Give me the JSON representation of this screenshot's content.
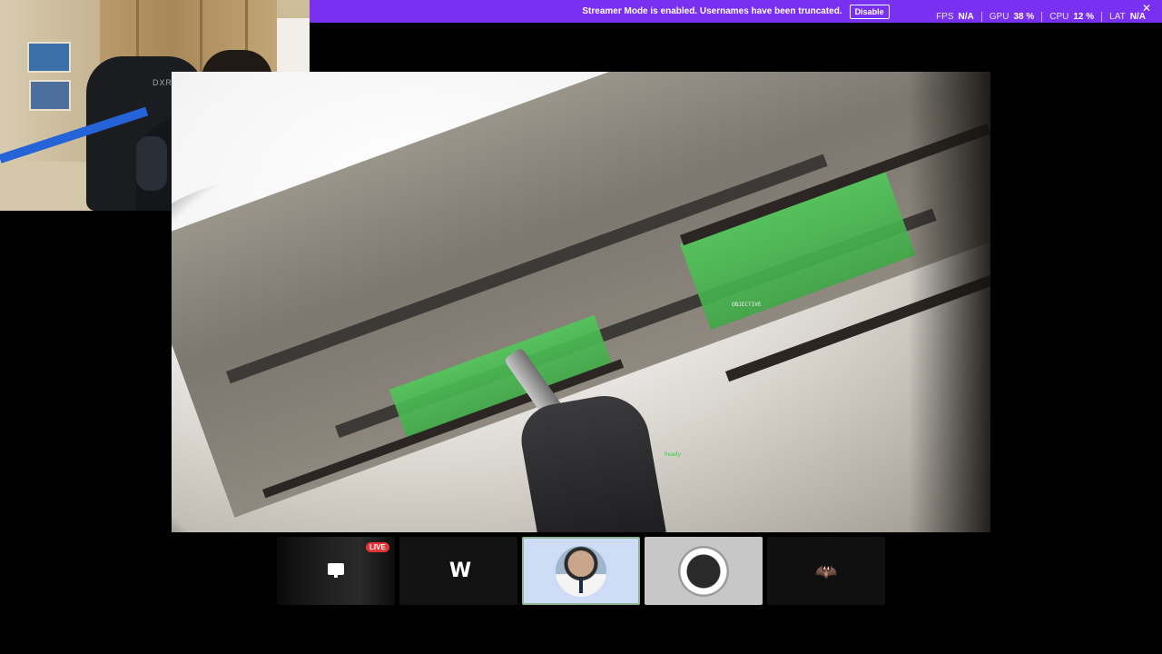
{
  "banner": {
    "message": "Streamer Mode is enabled. Usernames have been truncated.",
    "disable_label": "Disable",
    "close_glyph": "✕",
    "color": "#7a30f0"
  },
  "stats": [
    {
      "label": "FPS",
      "value": "N/A"
    },
    {
      "label": "GPU",
      "value": "38 %"
    },
    {
      "label": "CPU",
      "value": "12 %"
    },
    {
      "label": "LAT",
      "value": "N/A"
    }
  ],
  "webcam": {
    "chair_brand": "DXRACER"
  },
  "game": {
    "hud_marker": "OBJECTIVE",
    "hud_green_label": "Ready"
  },
  "tiles": [
    {
      "kind": "stream-preview",
      "badge": "LIVE",
      "icon": "screen-share-icon"
    },
    {
      "kind": "logo",
      "icon": "w-logo-icon"
    },
    {
      "kind": "avatar",
      "icon": "pilot-avatar",
      "active": true
    },
    {
      "kind": "avatar",
      "icon": "sketch-avatar"
    },
    {
      "kind": "logo",
      "icon": "red-bat-logo-icon"
    }
  ],
  "tile_glyphs": {
    "w_logo": "W",
    "red_logo": "🦇"
  }
}
